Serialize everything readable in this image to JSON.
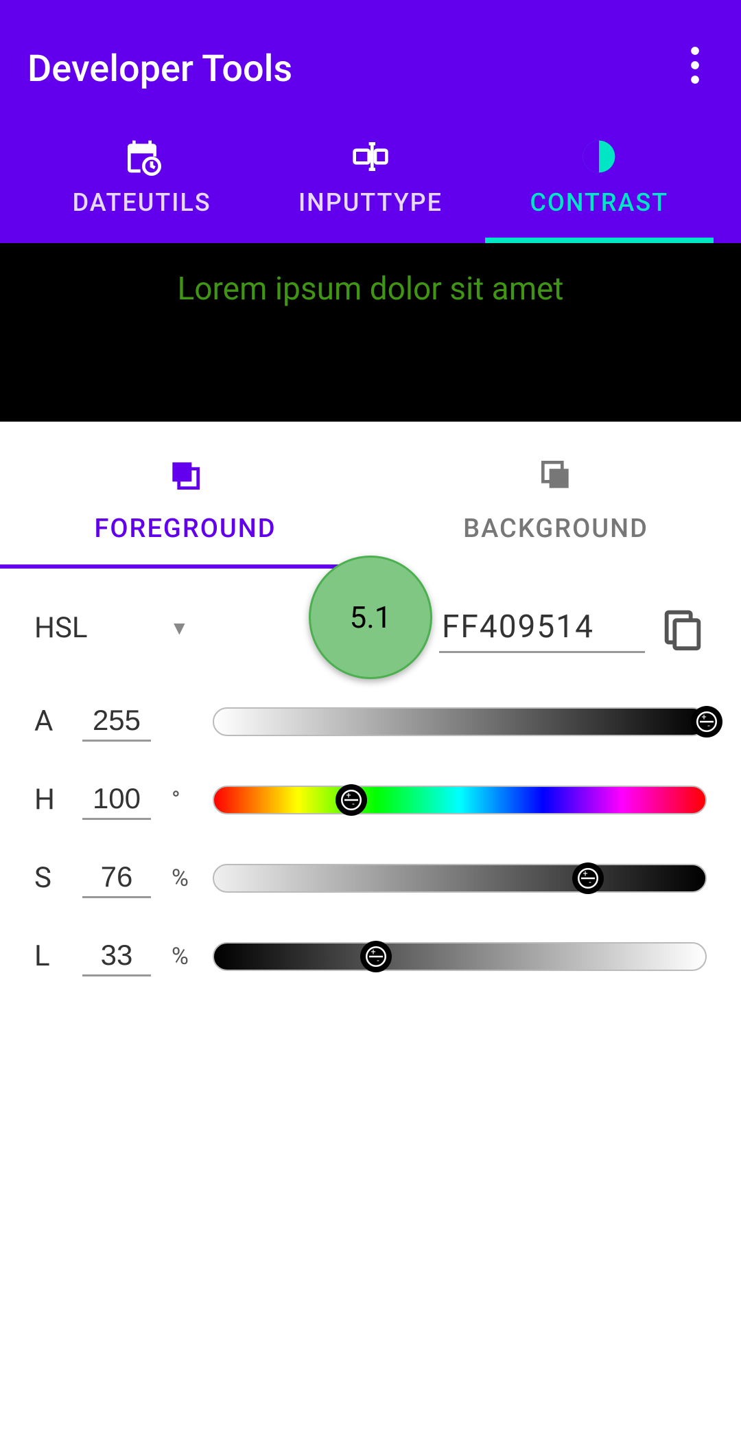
{
  "header": {
    "title": "Developer Tools"
  },
  "top_tabs": [
    {
      "label": "DATEUTILS",
      "active": false
    },
    {
      "label": "INPUTTYPE",
      "active": false
    },
    {
      "label": "CONTRAST",
      "active": true
    }
  ],
  "preview": {
    "sample_text": "Lorem ipsum dolor sit amet",
    "contrast_ratio": "5.1",
    "fg_color": "#409514",
    "bg_color": "#000000"
  },
  "fg_bg_tabs": {
    "foreground": "FOREGROUND",
    "background": "BACKGROUND",
    "active": "foreground"
  },
  "color_mode": "HSL",
  "hex_value": "FF409514",
  "sliders": {
    "a": {
      "label": "A",
      "value": "255",
      "unit": "",
      "max": 255,
      "pos_pct": 100
    },
    "h": {
      "label": "H",
      "value": "100",
      "unit": "°",
      "max": 360,
      "pos_pct": 28
    },
    "s": {
      "label": "S",
      "value": "76",
      "unit": "%",
      "max": 100,
      "pos_pct": 76
    },
    "l": {
      "label": "L",
      "value": "33",
      "unit": "%",
      "max": 100,
      "pos_pct": 33
    }
  }
}
